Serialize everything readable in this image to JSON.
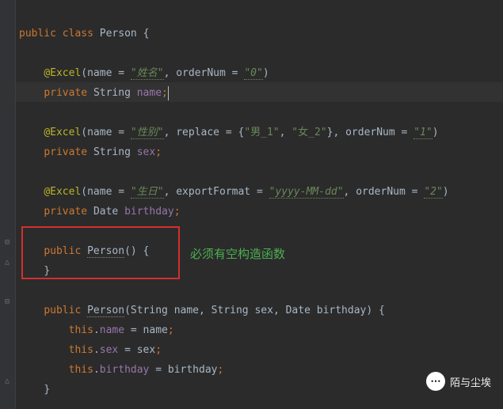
{
  "code": {
    "class_decl": {
      "kw_public": "public",
      "kw_class": "class",
      "name": "Person",
      "brace": "{"
    },
    "field1": {
      "anno": "@Excel",
      "lp": "(",
      "p_name": "name",
      "eq": " = ",
      "v_name": "\"姓名\"",
      "comma1": ", ",
      "p_order": "orderNum",
      "v_order": "\"0\"",
      "rp": ")",
      "kw_priv": "private",
      "type": "String",
      "field": "name",
      "semi": ";"
    },
    "field2": {
      "anno": "@Excel",
      "lp": "(",
      "p_name": "name",
      "eq": " = ",
      "v_name": "\"性别\"",
      "comma1": ", ",
      "p_repl": "replace",
      "v_repl_o": "{",
      "v_repl1": "\"男_1\"",
      "v_replc": ", ",
      "v_repl2": "\"女_2\"",
      "v_repl_c": "}",
      "comma2": ", ",
      "p_order": "orderNum",
      "v_order": "\"1\"",
      "rp": ")",
      "kw_priv": "private",
      "type": "String",
      "field": "sex",
      "semi": ";"
    },
    "field3": {
      "anno": "@Excel",
      "lp": "(",
      "p_name": "name",
      "eq": " = ",
      "v_name": "\"生日\"",
      "comma1": ", ",
      "p_fmt": "exportFormat",
      "v_fmt": "\"yyyy-MM-dd\"",
      "comma2": ", ",
      "p_order": "orderNum",
      "v_order": "\"2\"",
      "rp": ")",
      "kw_priv": "private",
      "type": "Date",
      "field": "birthday",
      "semi": ";"
    },
    "ctor1": {
      "kw_pub": "public",
      "name": "Person",
      "sig": "() {",
      "close": "}"
    },
    "ctor2": {
      "kw_pub": "public",
      "name": "Person",
      "lp": "(",
      "t1": "String",
      "p1": "name",
      "c1": ", ",
      "t2": "String",
      "p2": "sex",
      "c2": ", ",
      "t3": "Date",
      "p3": "birthday",
      "rp": ") {",
      "body1a": "this",
      "body1b": ".",
      "body1c": "name",
      "body1d": " = name",
      "body1e": ";",
      "body2a": "this",
      "body2b": ".",
      "body2c": "sex",
      "body2d": " = sex",
      "body2e": ";",
      "body3a": "this",
      "body3b": ".",
      "body3c": "birthday",
      "body3d": " = birthday",
      "body3e": ";",
      "close": "}"
    }
  },
  "annotation": "必须有空构造函数",
  "watermark": "陌与尘埃",
  "watermark_icon": "⋯"
}
